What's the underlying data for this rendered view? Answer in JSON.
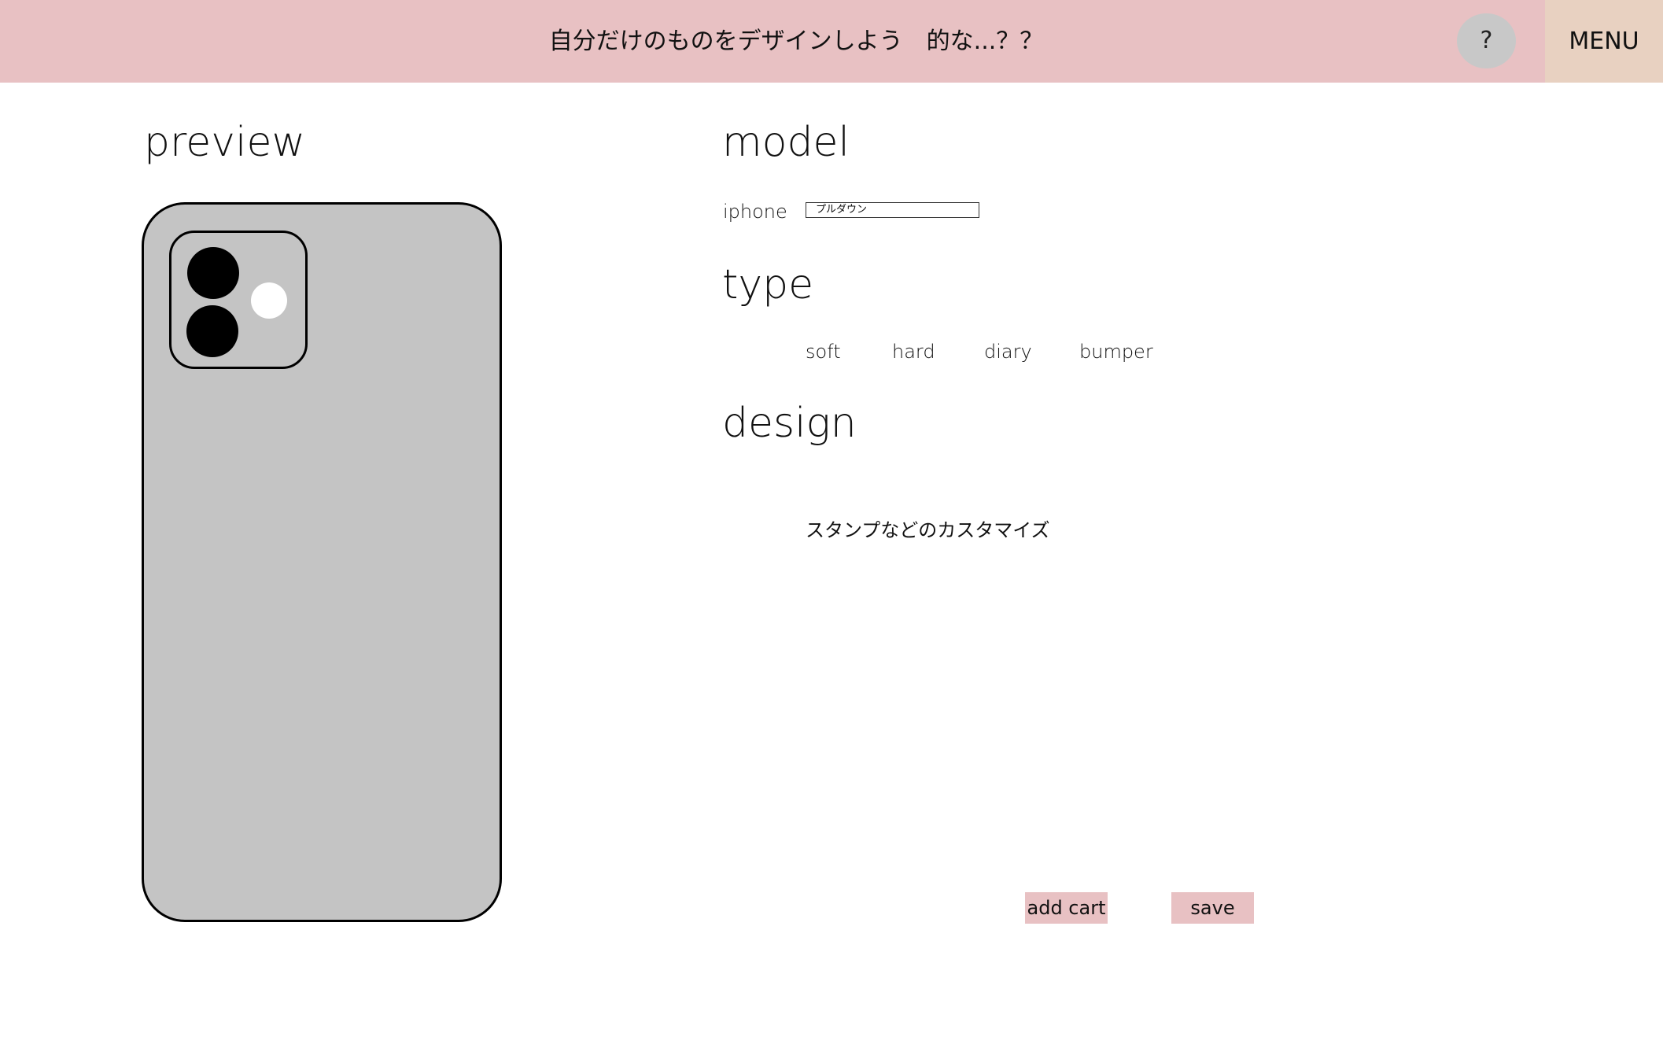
{
  "header": {
    "title": "自分だけのものをデザインしよう　的な...？？",
    "help_label": "?",
    "menu_label": "MENU"
  },
  "preview": {
    "title": "preview"
  },
  "model": {
    "title": "model",
    "label": "iphone",
    "select_value": "プルダウン"
  },
  "type": {
    "title": "type",
    "options": [
      "soft",
      "hard",
      "diary",
      "bumper"
    ]
  },
  "design": {
    "title": "design",
    "placeholder": "スタンプなどのカスタマイズ"
  },
  "actions": {
    "add_cart": "add cart",
    "save": "save"
  },
  "colors": {
    "header": "#e8c1c3",
    "menu": "#e8d1c1",
    "help": "#c8c8c8",
    "phone": "#c4c4c4",
    "button": "#e8c1c3"
  }
}
